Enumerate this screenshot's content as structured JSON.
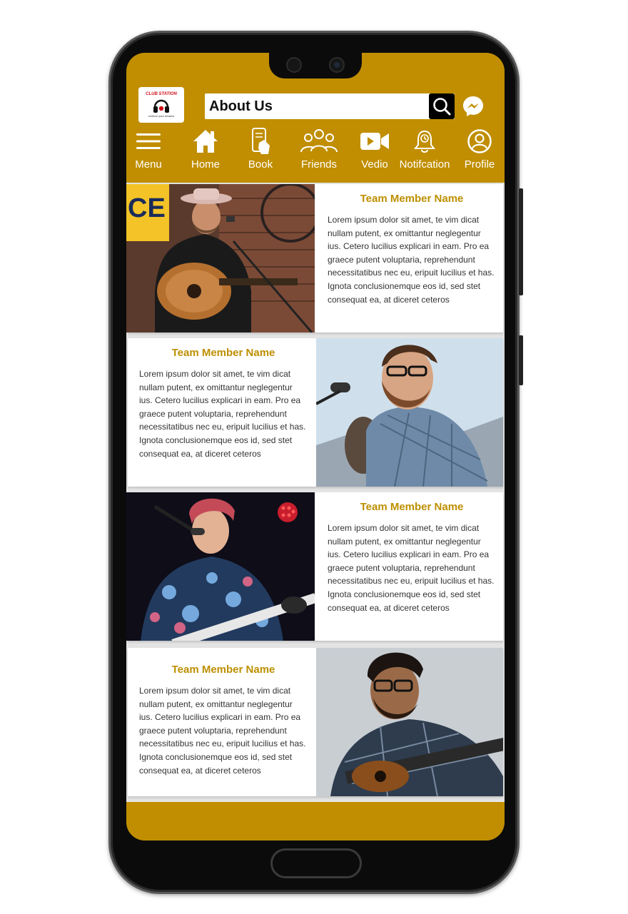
{
  "app": {
    "logo": {
      "brand": "CLUB STATION",
      "tagline": "venture your dreams"
    },
    "search": {
      "value": "About Us"
    },
    "theme": {
      "accent": "#c08e00",
      "title_color": "#bd8f00"
    }
  },
  "nav": {
    "items": [
      {
        "label": "Menu",
        "icon": "hamburger-icon"
      },
      {
        "label": "Home",
        "icon": "home-icon"
      },
      {
        "label": "Book",
        "icon": "book-phone-icon"
      },
      {
        "label": "Friends",
        "icon": "friends-icon"
      },
      {
        "label": "Vedio",
        "icon": "video-camera-icon"
      },
      {
        "label": "Notifcation",
        "icon": "bell-icon"
      },
      {
        "label": "Profile",
        "icon": "profile-icon"
      }
    ]
  },
  "team": [
    {
      "name": "Team Member Name",
      "bio": "Lorem ipsum dolor sit amet, te vim dicat nullam putent, ex omittantur neglegentur ius. Cetero lucilius explicari in eam. Pro ea graece putent voluptaria, reprehendunt necessitatibus nec eu, eripuit lucilius et has. Ignota conclusionemque eos id, sed stet consequat ea, at diceret ceteros"
    },
    {
      "name": "Team Member Name",
      "bio": "Lorem ipsum dolor sit amet, te vim dicat nullam putent, ex omittantur neglegentur ius. Cetero lucilius explicari in eam. Pro ea graece putent voluptaria, reprehendunt necessitatibus nec eu, eripuit lucilius et has. Ignota conclusionemque eos id, sed stet consequat ea, at diceret ceteros"
    },
    {
      "name": "Team Member Name",
      "bio": "Lorem ipsum dolor sit amet, te vim dicat nullam putent, ex omittantur neglegentur ius. Cetero lucilius explicari in eam. Pro ea graece putent voluptaria, reprehendunt necessitatibus nec eu, eripuit lucilius et has. Ignota conclusionemque eos id, sed stet consequat ea, at diceret ceteros"
    },
    {
      "name": "Team Member Name",
      "bio": "Lorem ipsum dolor sit amet, te vim dicat nullam putent, ex omittantur neglegentur ius. Cetero lucilius explicari in eam. Pro ea graece putent voluptaria, reprehendunt necessitatibus nec eu, eripuit lucilius et has. Ignota conclusionemque eos id, sed stet consequat ea, at diceret ceteros"
    }
  ]
}
